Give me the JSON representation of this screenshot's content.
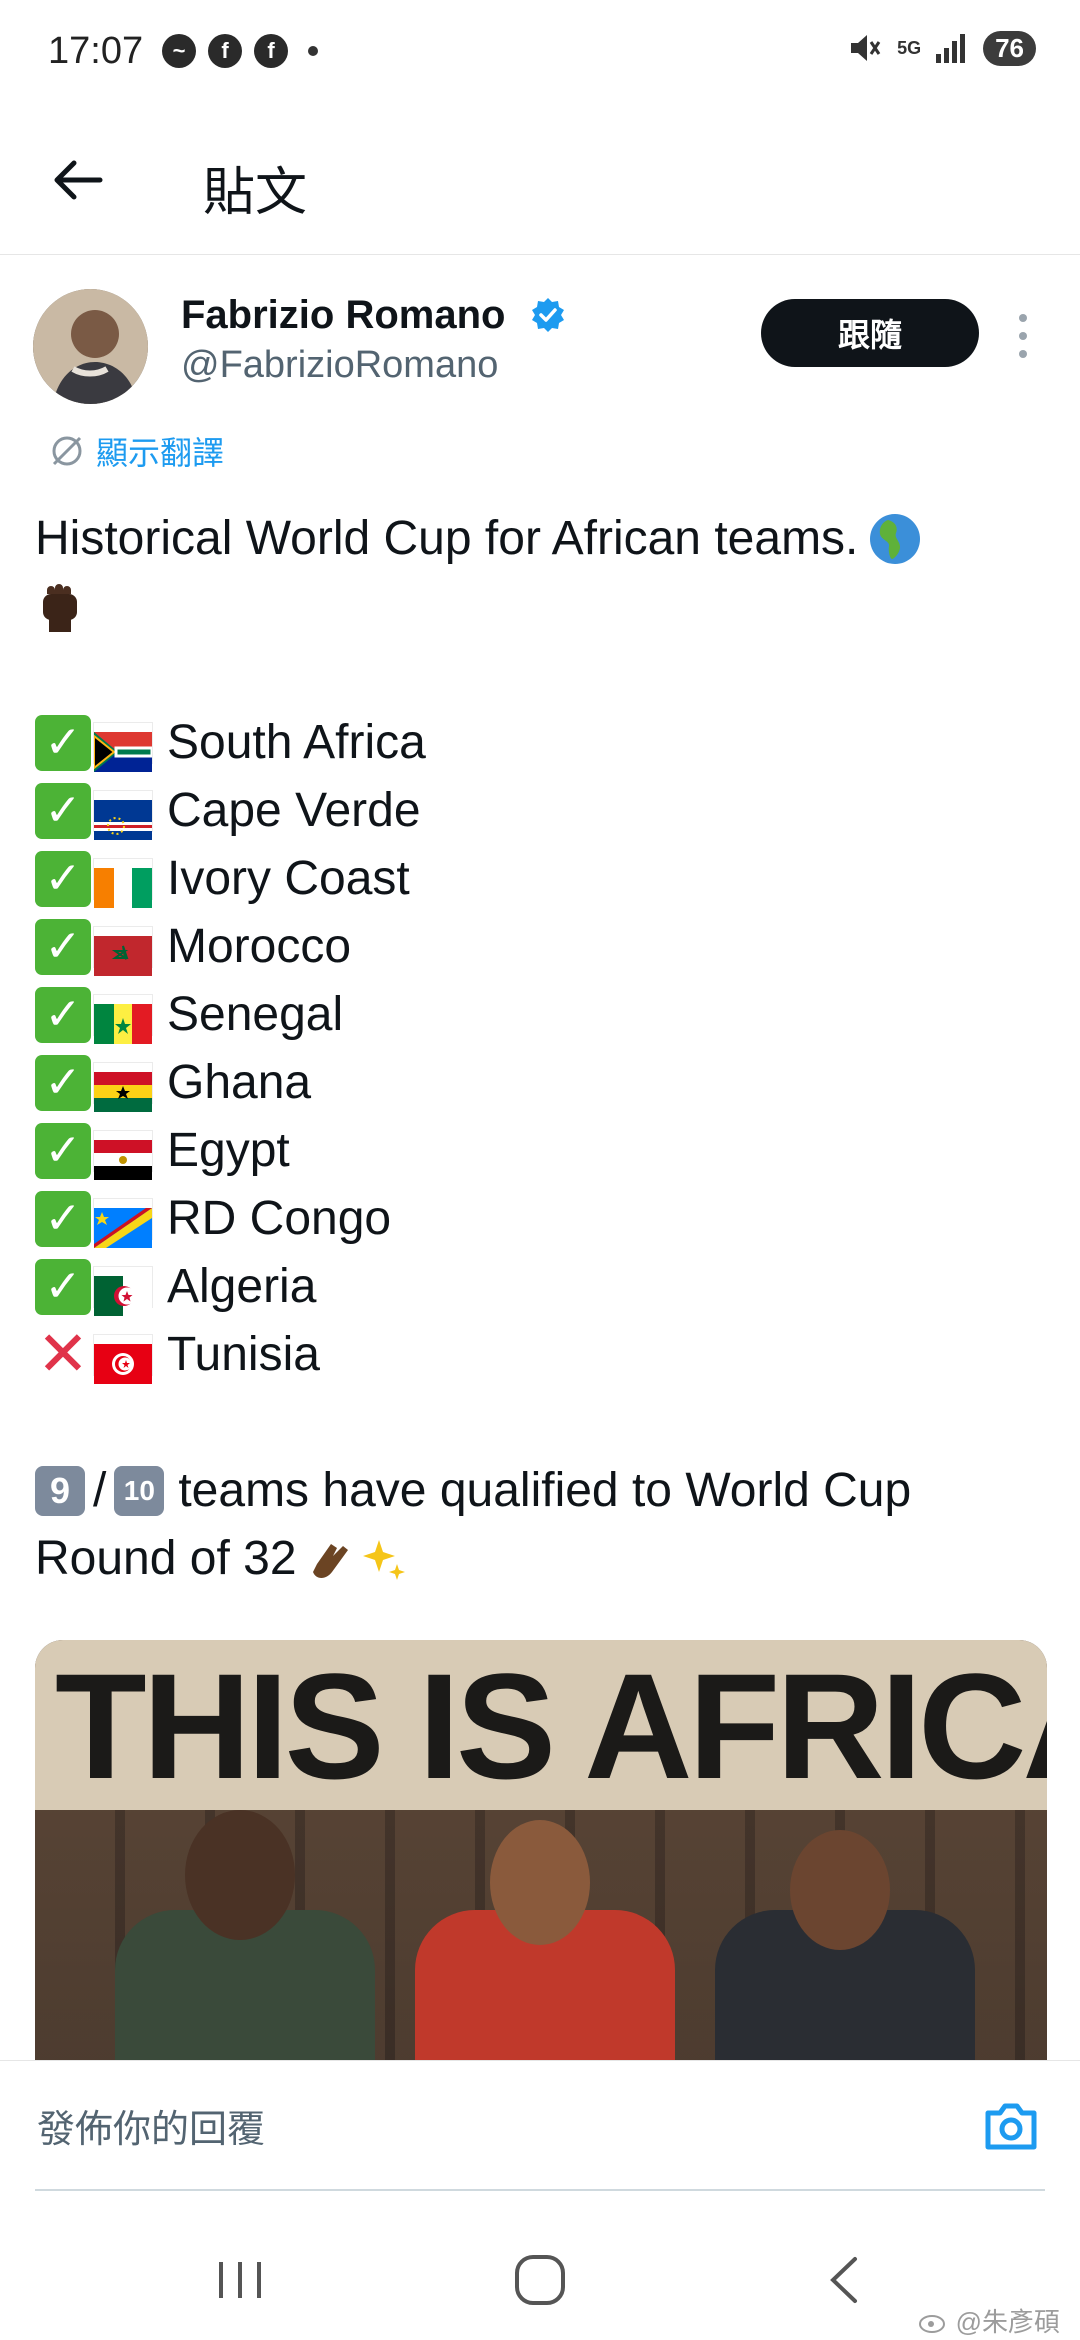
{
  "status_bar": {
    "time": "17:07",
    "network": "5G",
    "battery": "76",
    "notification_icons": [
      "messenger-icon",
      "facebook-icon",
      "facebook-icon"
    ]
  },
  "header": {
    "title": "貼文"
  },
  "tweet": {
    "author_name": "Fabrizio Romano",
    "author_handle": "@FabrizioRomano",
    "follow_label": "跟隨",
    "translate_label": "顯示翻譯",
    "headline": "Historical World Cup for African teams.",
    "teams": [
      {
        "name": "South Africa",
        "qualified": true
      },
      {
        "name": "Cape Verde",
        "qualified": true
      },
      {
        "name": "Ivory Coast",
        "qualified": true
      },
      {
        "name": "Morocco",
        "qualified": true
      },
      {
        "name": "Senegal",
        "qualified": true
      },
      {
        "name": "Ghana",
        "qualified": true
      },
      {
        "name": "Egypt",
        "qualified": true
      },
      {
        "name": "RD Congo",
        "qualified": true
      },
      {
        "name": "Algeria",
        "qualified": true
      },
      {
        "name": "Tunisia",
        "qualified": false
      }
    ],
    "summary_num": "9",
    "summary_den": "10",
    "summary_line1": "teams have qualified to World Cup",
    "summary_line2": "Round of 32",
    "image_banner_text": "THIS IS AFRICA"
  },
  "reply": {
    "placeholder": "發佈你的回覆"
  },
  "watermark": "@朱彥碩",
  "colors": {
    "accent": "#1d9bf0",
    "check_green": "#4cb336",
    "cross_red": "#e0334a"
  }
}
